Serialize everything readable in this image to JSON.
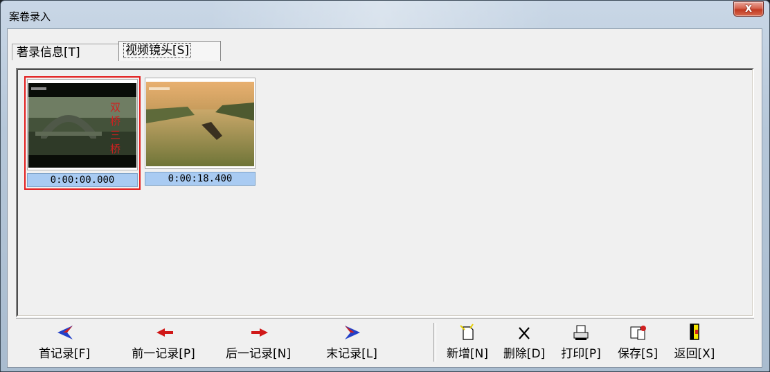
{
  "window": {
    "title": "案卷录入",
    "close_glyph": "X"
  },
  "tabs": [
    {
      "label": "著录信息[T]",
      "active": false
    },
    {
      "label": "视频镜头[S]",
      "active": true
    }
  ],
  "shots": [
    {
      "time": "0:00:00.000",
      "selected": true,
      "icon": "bridge-shot-thumbnail"
    },
    {
      "time": "0:00:18.400",
      "selected": false,
      "icon": "river-boat-thumbnail"
    }
  ],
  "toolbar": {
    "nav": [
      {
        "label": "首记录[F]",
        "icon": "first-record-arrow-icon"
      },
      {
        "label": "前一记录[P]",
        "icon": "prev-record-arrow-icon"
      },
      {
        "label": "后一记录[N]",
        "icon": "next-record-arrow-icon"
      },
      {
        "label": "末记录[L]",
        "icon": "last-record-arrow-icon"
      }
    ],
    "actions": [
      {
        "label": "新增[N]",
        "icon": "new-document-icon"
      },
      {
        "label": "删除[D]",
        "icon": "delete-x-icon"
      },
      {
        "label": "打印[P]",
        "icon": "printer-icon"
      },
      {
        "label": "保存[S]",
        "icon": "save-icon"
      },
      {
        "label": "返回[X]",
        "icon": "exit-door-icon"
      }
    ]
  },
  "colors": {
    "selection_border": "#e21c1c",
    "timecode_bg": "#a9cbf2",
    "close_button": "#c23a22"
  }
}
